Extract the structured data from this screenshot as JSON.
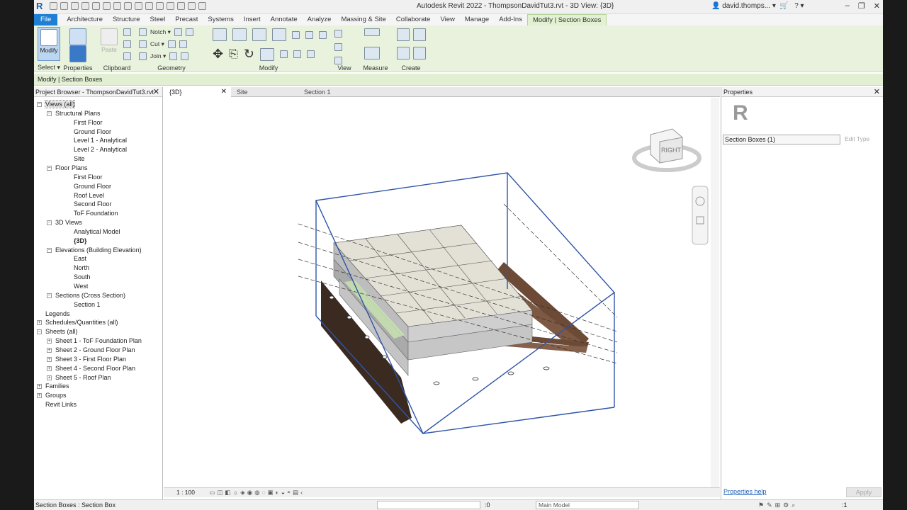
{
  "titlebar": {
    "logo": "R",
    "title": "Autodesk Revit 2022 - ThompsonDavidTut3.rvt - 3D View: {3D}",
    "user": "david.thomps...",
    "help": "?"
  },
  "tabs": [
    "File",
    "Architecture",
    "Structure",
    "Steel",
    "Precast",
    "Systems",
    "Insert",
    "Annotate",
    "Analyze",
    "Massing & Site",
    "Collaborate",
    "View",
    "Manage",
    "Add-Ins",
    "Modify | Section Boxes"
  ],
  "ribbon": {
    "modify_label": "Modify",
    "select_label": "Select ▾",
    "properties_label": "Properties",
    "paste_label": "Paste",
    "clipboard_label": "Clipboard",
    "notch_label": "Notch ▾",
    "cut_label": "Cut ▾",
    "join_label": "Join ▾",
    "geometry_label": "Geometry",
    "modify_group_label": "Modify",
    "view_label": "View",
    "measure_label": "Measure",
    "create_label": "Create"
  },
  "contextbar": {
    "text": "Modify | Section Boxes"
  },
  "browser": {
    "title": "Project Browser - ThompsonDavidTut3.rvt",
    "close": "✕",
    "items": [
      {
        "label": "Views (all)",
        "indent": 0,
        "exp": "−"
      },
      {
        "label": "Structural Plans",
        "indent": 1,
        "exp": "−"
      },
      {
        "label": "First Floor",
        "indent": 2
      },
      {
        "label": "Ground Floor",
        "indent": 2
      },
      {
        "label": "Level 1 - Analytical",
        "indent": 2
      },
      {
        "label": "Level 2 - Analytical",
        "indent": 2
      },
      {
        "label": "Site",
        "indent": 2
      },
      {
        "label": "Floor Plans",
        "indent": 1,
        "exp": "−"
      },
      {
        "label": "First Floor",
        "indent": 2
      },
      {
        "label": "Ground Floor",
        "indent": 2
      },
      {
        "label": "Roof Level",
        "indent": 2
      },
      {
        "label": "Second Floor",
        "indent": 2
      },
      {
        "label": "ToF Foundation",
        "indent": 2
      },
      {
        "label": "3D Views",
        "indent": 1,
        "exp": "−"
      },
      {
        "label": "Analytical Model",
        "indent": 2
      },
      {
        "label": "{3D}",
        "indent": 2,
        "bold": true
      },
      {
        "label": "Elevations (Building Elevation)",
        "indent": 1,
        "exp": "−"
      },
      {
        "label": "East",
        "indent": 2
      },
      {
        "label": "North",
        "indent": 2
      },
      {
        "label": "South",
        "indent": 2
      },
      {
        "label": "West",
        "indent": 2
      },
      {
        "label": "Sections (Cross Section)",
        "indent": 1,
        "exp": "−"
      },
      {
        "label": "Section 1",
        "indent": 2
      },
      {
        "label": "Legends",
        "indent": 0
      },
      {
        "label": "Schedules/Quantities (all)",
        "indent": 0,
        "exp": "+"
      },
      {
        "label": "Sheets (all)",
        "indent": 0,
        "exp": "−"
      },
      {
        "label": "Sheet 1 - ToF Foundation Plan",
        "indent": 1,
        "exp": "+"
      },
      {
        "label": "Sheet 2 - Ground Floor Plan",
        "indent": 1,
        "exp": "+"
      },
      {
        "label": "Sheet 3 - First Floor Plan",
        "indent": 1,
        "exp": "+"
      },
      {
        "label": "Sheet 4 - Second Floor Plan",
        "indent": 1,
        "exp": "+"
      },
      {
        "label": "Sheet 5 - Roof Plan",
        "indent": 1,
        "exp": "+"
      },
      {
        "label": "Families",
        "indent": 0,
        "exp": "+"
      },
      {
        "label": "Groups",
        "indent": 0,
        "exp": "+"
      },
      {
        "label": "Revit Links",
        "indent": 0
      }
    ]
  },
  "viewtabs": [
    {
      "label": "{3D}",
      "active": true,
      "close": "✕"
    },
    {
      "label": "Site",
      "active": false
    },
    {
      "label": "Section 1",
      "active": false
    }
  ],
  "viewcube": {
    "face": "RIGHT"
  },
  "viewbar": {
    "scale": "1 : 100"
  },
  "properties": {
    "title": "Properties",
    "close": "✕",
    "type_selector": "Section Boxes (1)",
    "edit_type": "Edit Type",
    "help_link": "Properties help",
    "apply": "Apply"
  },
  "statusbar": {
    "text": "Section Boxes : Section Box",
    "coord": ":0",
    "model": "Main Model",
    "filter_count": ":1"
  }
}
